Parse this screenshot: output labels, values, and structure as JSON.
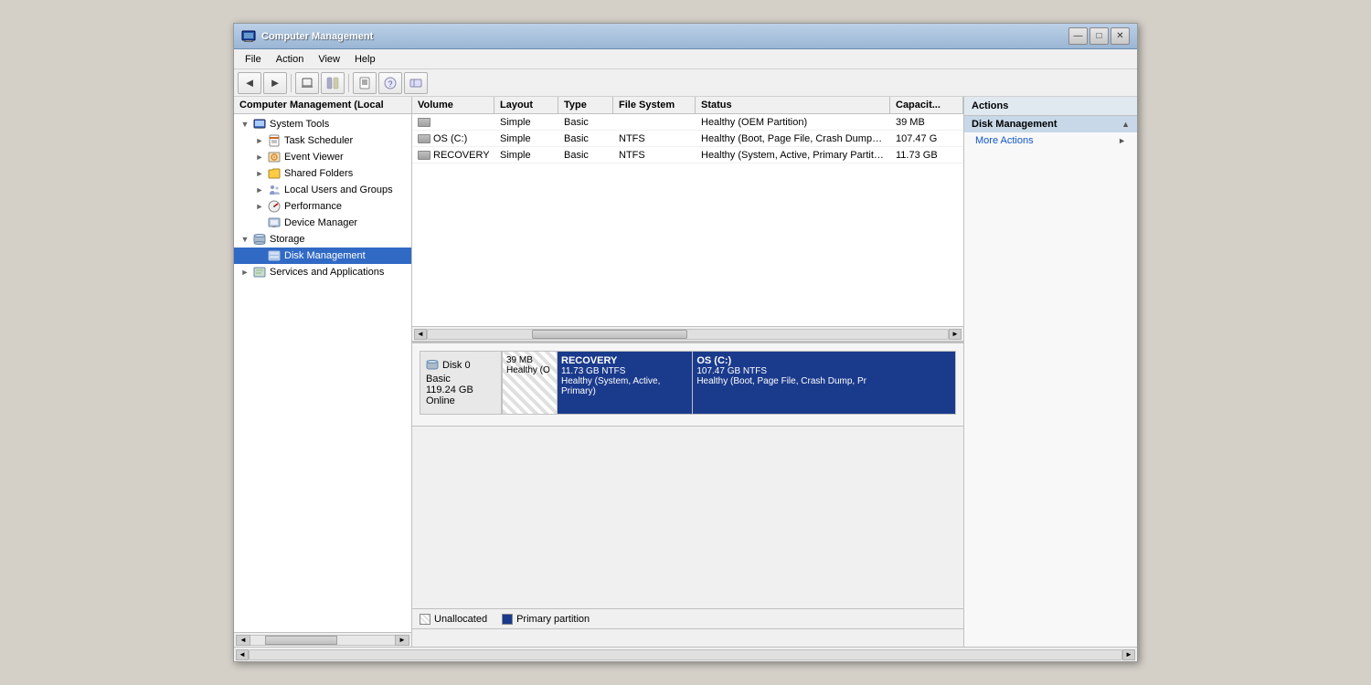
{
  "window": {
    "title": "Computer Management",
    "minimize_label": "—",
    "maximize_label": "□",
    "close_label": "✕"
  },
  "menu": {
    "items": [
      "File",
      "Action",
      "View",
      "Help"
    ]
  },
  "toolbar": {
    "buttons": [
      "◄",
      "►",
      "🗑",
      "🗂",
      "🔧",
      "⚙",
      "📋"
    ]
  },
  "left_panel": {
    "header": "Computer Management (Local",
    "tree": [
      {
        "id": "system-tools",
        "label": "System Tools",
        "indent": 1,
        "expanded": true,
        "has_expand": true,
        "icon": "computer"
      },
      {
        "id": "task-scheduler",
        "label": "Task Scheduler",
        "indent": 2,
        "has_expand": true,
        "icon": "task"
      },
      {
        "id": "event-viewer",
        "label": "Event Viewer",
        "indent": 2,
        "has_expand": true,
        "icon": "event"
      },
      {
        "id": "shared-folders",
        "label": "Shared Folders",
        "indent": 2,
        "has_expand": true,
        "icon": "folder"
      },
      {
        "id": "local-users",
        "label": "Local Users and Groups",
        "indent": 2,
        "has_expand": true,
        "icon": "users"
      },
      {
        "id": "performance",
        "label": "Performance",
        "indent": 2,
        "has_expand": true,
        "icon": "perf"
      },
      {
        "id": "device-manager",
        "label": "Device Manager",
        "indent": 2,
        "has_expand": false,
        "icon": "device"
      },
      {
        "id": "storage",
        "label": "Storage",
        "indent": 1,
        "expanded": true,
        "has_expand": true,
        "icon": "storage"
      },
      {
        "id": "disk-management",
        "label": "Disk Management",
        "indent": 2,
        "has_expand": false,
        "icon": "disk",
        "selected": true
      },
      {
        "id": "services",
        "label": "Services and Applications",
        "indent": 1,
        "has_expand": true,
        "icon": "services"
      }
    ]
  },
  "table": {
    "columns": [
      {
        "id": "volume",
        "label": "Volume"
      },
      {
        "id": "layout",
        "label": "Layout"
      },
      {
        "id": "type",
        "label": "Type"
      },
      {
        "id": "filesystem",
        "label": "File System"
      },
      {
        "id": "status",
        "label": "Status"
      },
      {
        "id": "capacity",
        "label": "Capacit..."
      }
    ],
    "rows": [
      {
        "volume": "",
        "layout": "Simple",
        "type": "Basic",
        "filesystem": "",
        "status": "Healthy (OEM Partition)",
        "capacity": "39 MB",
        "has_icon": true
      },
      {
        "volume": "OS (C:)",
        "layout": "Simple",
        "type": "Basic",
        "filesystem": "NTFS",
        "status": "Healthy (Boot, Page File, Crash Dump, Primary Partition)",
        "capacity": "107.47 G",
        "has_icon": true
      },
      {
        "volume": "RECOVERY",
        "layout": "Simple",
        "type": "Basic",
        "filesystem": "NTFS",
        "status": "Healthy (System, Active, Primary Partition)",
        "capacity": "11.73 GB",
        "has_icon": true
      }
    ]
  },
  "disk_viz": {
    "disk_label": "Disk 0",
    "disk_type": "Basic",
    "disk_size": "119.24 GB",
    "disk_status": "Online",
    "partitions": [
      {
        "name": "",
        "size": "39 MB",
        "type": "unallocated",
        "info": "Healthy (O"
      },
      {
        "name": "RECOVERY",
        "size": "11.73 GB NTFS",
        "type": "recovery",
        "info": "Healthy (System, Active, Primary)"
      },
      {
        "name": "OS  (C:)",
        "size": "107.47 GB NTFS",
        "type": "os",
        "info": "Healthy (Boot, Page File, Crash Dump, Pr"
      }
    ]
  },
  "legend": {
    "items": [
      {
        "label": "Unallocated",
        "type": "unalloc"
      },
      {
        "label": "Primary partition",
        "type": "primary"
      }
    ]
  },
  "actions_panel": {
    "header": "Actions",
    "section1": {
      "label": "Disk Management",
      "chevron": "▲"
    },
    "more_actions": {
      "label": "More Actions",
      "chevron": "►"
    }
  }
}
